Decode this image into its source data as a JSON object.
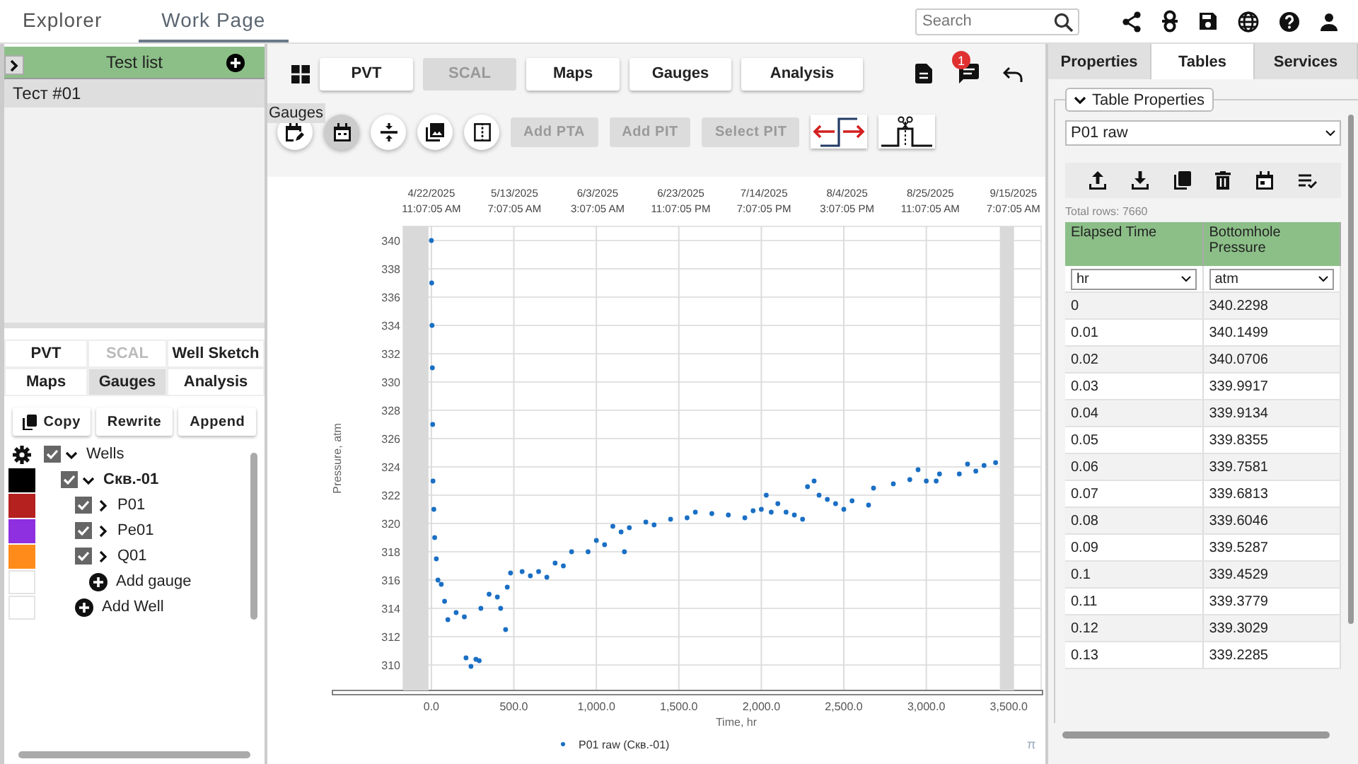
{
  "header": {
    "tabs": [
      {
        "label": "Explorer",
        "selected": false
      },
      {
        "label": "Work Page",
        "selected": true
      }
    ],
    "search": {
      "placeholder": "Search"
    }
  },
  "left_panel": {
    "test_list": {
      "title": "Test list",
      "items": [
        {
          "label": "Тест #01",
          "selected": true
        }
      ]
    },
    "tabs": [
      {
        "label": "PVT",
        "selected": false,
        "disabled": false
      },
      {
        "label": "SCAL",
        "selected": false,
        "disabled": true
      },
      {
        "label": "Well Sketch",
        "selected": false,
        "disabled": false
      },
      {
        "label": "Maps",
        "selected": false,
        "disabled": false
      },
      {
        "label": "Gauges",
        "selected": true,
        "disabled": false
      },
      {
        "label": "Analysis",
        "selected": false,
        "disabled": false
      }
    ],
    "actions": [
      "Copy",
      "Rewrite",
      "Append"
    ],
    "tree": {
      "label": "Wells",
      "checked": true,
      "expanded": true,
      "children": [
        {
          "label": "Скв.-01",
          "checked": true,
          "expanded": true,
          "color": "#000000",
          "children": [
            {
              "label": "P01",
              "checked": true,
              "expanded": false,
              "color": "#b5211f"
            },
            {
              "label": "Pe01",
              "checked": true,
              "expanded": false,
              "color": "#8e2fe0"
            },
            {
              "label": "Q01",
              "checked": true,
              "expanded": false,
              "color": "#ff8c1a"
            }
          ],
          "add_label": "Add gauge"
        }
      ],
      "add_label": "Add Well"
    }
  },
  "work_page": {
    "nav_tabs": [
      {
        "label": "PVT",
        "disabled": false
      },
      {
        "label": "SCAL",
        "disabled": true
      },
      {
        "label": "Maps",
        "disabled": false
      },
      {
        "label": "Gauges",
        "disabled": false
      },
      {
        "label": "Analysis",
        "disabled": false
      }
    ],
    "notification_count": "1",
    "tooltip": "Gauges",
    "tool_buttons": [
      {
        "kind": "edit-calendar",
        "selected": false
      },
      {
        "kind": "calendar",
        "selected": true
      },
      {
        "kind": "compress",
        "selected": false
      },
      {
        "kind": "photos",
        "selected": false
      },
      {
        "kind": "split",
        "selected": false
      }
    ],
    "text_buttons": [
      {
        "label": "Add PTA",
        "disabled": true
      },
      {
        "label": "Add PIT",
        "disabled": true
      },
      {
        "label": "Select PIT",
        "disabled": true
      }
    ],
    "chart": {
      "date_ticks": [
        {
          "date": "4/22/2025",
          "time": "11:07:05 AM"
        },
        {
          "date": "5/13/2025",
          "time": "7:07:05 AM"
        },
        {
          "date": "6/3/2025",
          "time": "3:07:05 AM"
        },
        {
          "date": "6/23/2025",
          "time": "11:07:05 PM"
        },
        {
          "date": "7/14/2025",
          "time": "7:07:05 PM"
        },
        {
          "date": "8/4/2025",
          "time": "3:07:05 PM"
        },
        {
          "date": "8/25/2025",
          "time": "11:07:05 AM"
        },
        {
          "date": "9/15/2025",
          "time": "7:07:05 AM"
        }
      ],
      "corner_mark": "π",
      "chart_data": {
        "type": "scatter",
        "grid": true,
        "xlabel": "Time, hr",
        "ylabel": "Pressure, atm",
        "xlim": [
          -171,
          3696
        ],
        "ylim": [
          308.2,
          341
        ],
        "xticks": [
          {
            "value": 0,
            "label": "0.0"
          },
          {
            "value": 500,
            "label": "500.0"
          },
          {
            "value": 1000,
            "label": "1,000.0"
          },
          {
            "value": 1500,
            "label": "1,500.0"
          },
          {
            "value": 2000,
            "label": "2,000.0"
          },
          {
            "value": 2500,
            "label": "2,500.0"
          },
          {
            "value": 3000,
            "label": "3,000.0"
          },
          {
            "value": 3500,
            "label": "3,500.0"
          }
        ],
        "yticks": [
          310,
          312,
          314,
          316,
          318,
          320,
          322,
          324,
          326,
          328,
          330,
          332,
          334,
          336,
          338,
          340
        ],
        "x": [
          0,
          2,
          4,
          6,
          8,
          10,
          15,
          20,
          30,
          40,
          60,
          80,
          100,
          150,
          200,
          210,
          240,
          270,
          290,
          300,
          350,
          400,
          420,
          450,
          460,
          480,
          550,
          600,
          650,
          700,
          750,
          800,
          850,
          950,
          1000,
          1050,
          1100,
          1150,
          1170,
          1200,
          1300,
          1350,
          1450,
          1550,
          1600,
          1700,
          1800,
          1900,
          1950,
          2000,
          2030,
          2060,
          2100,
          2150,
          2200,
          2250,
          2280,
          2320,
          2350,
          2400,
          2450,
          2500,
          2550,
          2650,
          2680,
          2800,
          2900,
          2950,
          3000,
          3060,
          3080,
          3200,
          3250,
          3300,
          3350,
          3420
        ],
        "series": [
          {
            "name": "P01 raw (Скв.-01)",
            "color": "#1a6fc4",
            "values": [
              340,
              337,
              334,
              331,
              327,
              323,
              321,
              319,
              317.5,
              316,
              315.7,
              314.5,
              313.2,
              313.7,
              313.4,
              310.5,
              309.9,
              310.4,
              310.3,
              314,
              315,
              314.8,
              314,
              312.5,
              315.5,
              316.5,
              316.6,
              316.3,
              316.6,
              316.2,
              317.2,
              317,
              318,
              318,
              318.8,
              318.5,
              319.8,
              319.4,
              318,
              319.7,
              320.1,
              319.9,
              320.3,
              320.4,
              320.8,
              320.7,
              320.6,
              320.4,
              320.9,
              321,
              322,
              320.8,
              321.4,
              320.8,
              320.6,
              320.3,
              322.6,
              323,
              322,
              321.7,
              321.4,
              321,
              321.6,
              321.3,
              322.5,
              322.8,
              323.1,
              323.8,
              323,
              323,
              323.5,
              323.5,
              324.2,
              323.7,
              324.1,
              324.3
            ]
          }
        ]
      }
    }
  },
  "right_panel": {
    "tabs": [
      {
        "label": "Properties",
        "selected": false
      },
      {
        "label": "Tables",
        "selected": true
      },
      {
        "label": "Services",
        "selected": false
      }
    ],
    "table_properties": {
      "title": "Table Properties",
      "expanded": true,
      "source": "P01 raw",
      "total_rows": "Total rows: 7660",
      "columns": [
        {
          "title": "Elapsed Time",
          "unit": "hr"
        },
        {
          "title": "Bottomhole Pressure",
          "unit": "atm"
        }
      ],
      "rows": [
        [
          "0",
          "340.2298"
        ],
        [
          "0.01",
          "340.1499"
        ],
        [
          "0.02",
          "340.0706"
        ],
        [
          "0.03",
          "339.9917"
        ],
        [
          "0.04",
          "339.9134"
        ],
        [
          "0.05",
          "339.8355"
        ],
        [
          "0.06",
          "339.7581"
        ],
        [
          "0.07",
          "339.6813"
        ],
        [
          "0.08",
          "339.6046"
        ],
        [
          "0.09",
          "339.5287"
        ],
        [
          "0.1",
          "339.4529"
        ],
        [
          "0.11",
          "339.3779"
        ],
        [
          "0.12",
          "339.3029"
        ],
        [
          "0.13",
          "339.2285"
        ]
      ]
    }
  }
}
